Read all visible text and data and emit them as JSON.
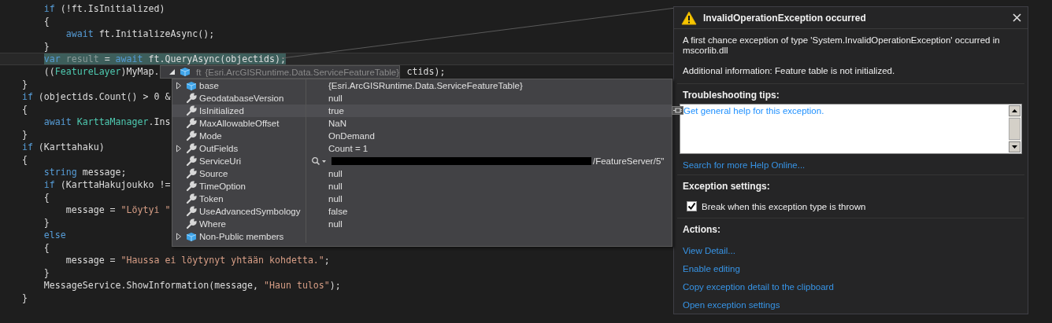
{
  "code_lines": [
    {
      "highlighted": false,
      "tokens": [
        {
          "kind": "keyword",
          "text": "if"
        },
        {
          "kind": "plain",
          "text": " (!ft.IsInitialized)"
        }
      ]
    },
    {
      "highlighted": false,
      "tokens": [
        {
          "kind": "plain",
          "text": "{"
        }
      ]
    },
    {
      "highlighted": false,
      "tokens": [
        {
          "kind": "keyword",
          "text": "await"
        },
        {
          "kind": "plain",
          "text": " ft.InitializeAsync();"
        }
      ]
    },
    {
      "highlighted": false,
      "tokens": [
        {
          "kind": "plain",
          "text": "}"
        }
      ]
    },
    {
      "highlighted": true,
      "tokens": [
        {
          "kind": "keyword",
          "text": "var"
        },
        {
          "kind": "unused",
          "text": " result"
        },
        {
          "kind": "plain",
          "text": " = "
        },
        {
          "kind": "keyword",
          "text": "await"
        },
        {
          "kind": "plain",
          "text": " ft.QueryAsync(objectids);"
        }
      ]
    },
    {
      "highlighted": false,
      "tokens": [
        {
          "kind": "plain",
          "text": "(("
        },
        {
          "kind": "type",
          "text": "FeatureLayer"
        },
        {
          "kind": "plain",
          "text": ")MyMap."
        }
      ],
      "tail": "ctids);"
    },
    {
      "highlighted": false,
      "tokens": [
        {
          "kind": "plain",
          "text": "}"
        }
      ]
    },
    {
      "highlighted": false,
      "tokens": [
        {
          "kind": "keyword",
          "text": "if"
        },
        {
          "kind": "plain",
          "text": " (objectids.Count() > 0 &"
        }
      ]
    },
    {
      "highlighted": false,
      "tokens": [
        {
          "kind": "plain",
          "text": "{"
        }
      ]
    },
    {
      "highlighted": false,
      "tokens": [
        {
          "kind": "keyword",
          "text": "await"
        },
        {
          "kind": "type",
          "text": " KarttaManager"
        },
        {
          "kind": "plain",
          "text": ".Ins"
        }
      ]
    },
    {
      "highlighted": false,
      "tokens": [
        {
          "kind": "plain",
          "text": "}"
        }
      ]
    },
    {
      "highlighted": false,
      "tokens": [
        {
          "kind": "keyword",
          "text": "if"
        },
        {
          "kind": "plain",
          "text": " (Karttahaku)"
        }
      ]
    },
    {
      "highlighted": false,
      "tokens": [
        {
          "kind": "plain",
          "text": "{"
        }
      ]
    },
    {
      "highlighted": false,
      "tokens": [
        {
          "kind": "keyword",
          "text": "string"
        },
        {
          "kind": "plain",
          "text": " message;"
        }
      ]
    },
    {
      "highlighted": false,
      "tokens": [
        {
          "kind": "keyword",
          "text": "if"
        },
        {
          "kind": "plain",
          "text": " (KarttaHakujoukko !="
        }
      ]
    },
    {
      "highlighted": false,
      "tokens": [
        {
          "kind": "plain",
          "text": "{"
        }
      ]
    },
    {
      "highlighted": false,
      "tokens": [
        {
          "kind": "plain",
          "text": "message = "
        },
        {
          "kind": "string",
          "text": "\"Löytyi \""
        }
      ]
    },
    {
      "highlighted": false,
      "tokens": [
        {
          "kind": "plain",
          "text": "}"
        }
      ]
    },
    {
      "highlighted": false,
      "tokens": [
        {
          "kind": "keyword",
          "text": "else"
        }
      ]
    },
    {
      "highlighted": false,
      "tokens": [
        {
          "kind": "plain",
          "text": "{"
        }
      ]
    },
    {
      "highlighted": false,
      "tokens": [
        {
          "kind": "plain",
          "text": "message = "
        },
        {
          "kind": "string",
          "text": "\"Haussa ei löytynyt yhtään kohdetta.\""
        },
        {
          "kind": "plain",
          "text": ";"
        }
      ]
    },
    {
      "highlighted": false,
      "tokens": [
        {
          "kind": "plain",
          "text": "}"
        }
      ]
    },
    {
      "highlighted": false,
      "tokens": [
        {
          "kind": "plain",
          "text": "MessageService.ShowInformation(message, "
        },
        {
          "kind": "string",
          "text": "\"Haun tulos\""
        },
        {
          "kind": "plain",
          "text": ");"
        }
      ]
    },
    {
      "highlighted": false,
      "tokens": [
        {
          "kind": "plain",
          "text": "}"
        }
      ]
    }
  ],
  "datatip": {
    "header": {
      "expanded": true,
      "name": "ft",
      "value": "{Esri.ArcGISRuntime.Data.ServiceFeatureTable}"
    },
    "rows": [
      {
        "name": "base",
        "value": "{Esri.ArcGISRuntime.Data.ServiceFeatureTable}",
        "kind": "object",
        "expandable": true,
        "selected": false
      },
      {
        "name": "GeodatabaseVersion",
        "value": "null",
        "kind": "property",
        "expandable": false,
        "selected": false
      },
      {
        "name": "IsInitialized",
        "value": "true",
        "kind": "property",
        "expandable": false,
        "selected": true
      },
      {
        "name": "MaxAllowableOffset",
        "value": "NaN",
        "kind": "property",
        "expandable": false,
        "selected": false
      },
      {
        "name": "Mode",
        "value": "OnDemand",
        "kind": "property",
        "expandable": false,
        "selected": false
      },
      {
        "name": "OutFields",
        "value": "Count = 1",
        "kind": "property",
        "expandable": true,
        "selected": false
      },
      {
        "name": "ServiceUri",
        "value": "/FeatureServer/5\"",
        "kind": "property",
        "expandable": false,
        "selected": false,
        "redacted": true,
        "visualizer": true
      },
      {
        "name": "Source",
        "value": "null",
        "kind": "property",
        "expandable": false,
        "selected": false
      },
      {
        "name": "TimeOption",
        "value": "null",
        "kind": "property",
        "expandable": false,
        "selected": false
      },
      {
        "name": "Token",
        "value": "null",
        "kind": "property",
        "expandable": false,
        "selected": false
      },
      {
        "name": "UseAdvancedSymbology",
        "value": "false",
        "kind": "property",
        "expandable": false,
        "selected": false
      },
      {
        "name": "Where",
        "value": "null",
        "kind": "property",
        "expandable": false,
        "selected": false
      },
      {
        "name": "Non-Public members",
        "kind": "object",
        "expandable": true,
        "selected": false
      }
    ]
  },
  "exception": {
    "title": "InvalidOperationException occurred",
    "message": "A first chance exception of type 'System.InvalidOperationException' occurred in mscorlib.dll",
    "additional_info": "Additional information: Feature table is not initialized.",
    "tips_heading": "Troubleshooting tips:",
    "tips_link": "Get general help for this exception.",
    "help_link": "Search for more Help Online...",
    "settings_heading": "Exception settings:",
    "break_option": {
      "label": "Break when this exception type is thrown",
      "checked": true
    },
    "actions_heading": "Actions:",
    "actions": [
      "View Detail...",
      "Enable editing",
      "Copy exception detail to the clipboard",
      "Open exception settings"
    ]
  }
}
